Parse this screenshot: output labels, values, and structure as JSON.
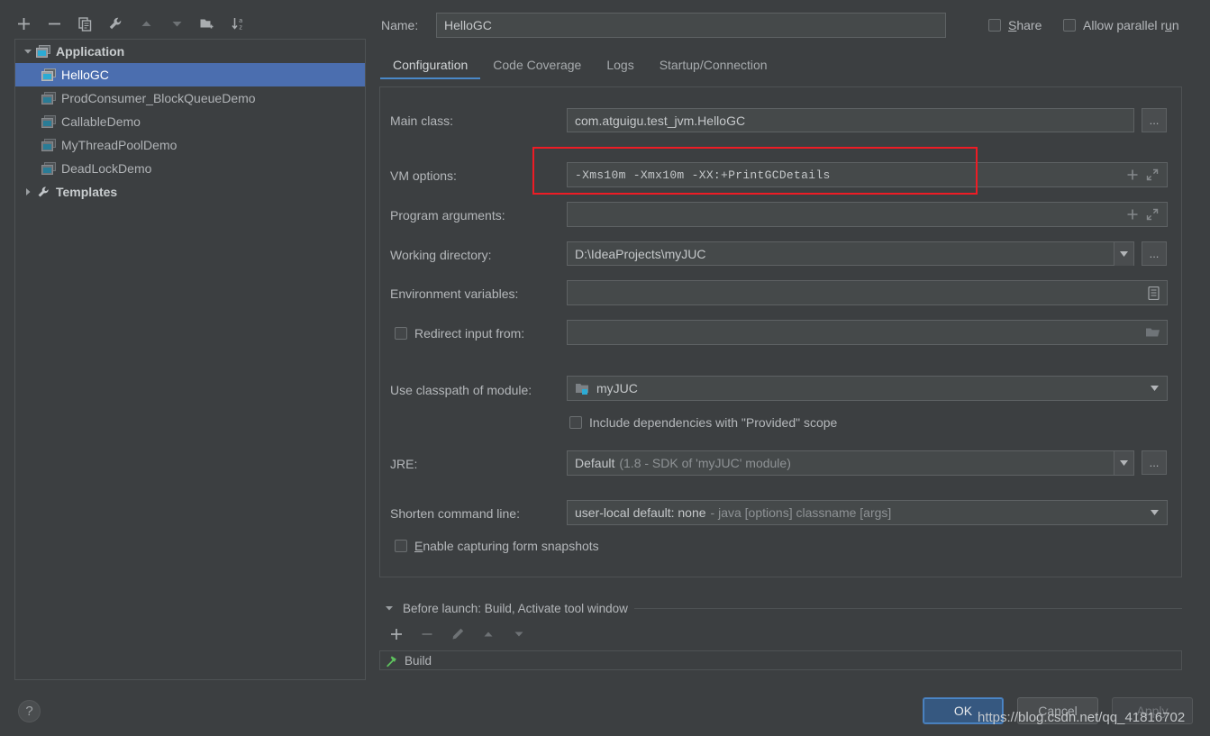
{
  "colors": {
    "background": "#3c3f41",
    "selection_blue": "#4b6eaf",
    "accent_tab": "#4a88c7",
    "ok_button": "#365880",
    "highlight_red": "#ee1c25",
    "field_background": "#45494a",
    "text": "#b4b7ba"
  },
  "tree_toolbar": {
    "items": [
      {
        "icon": "plus-icon",
        "enabled": true
      },
      {
        "icon": "minus-icon",
        "enabled": true
      },
      {
        "icon": "copy-icon",
        "enabled": true
      },
      {
        "icon": "wrench-icon",
        "enabled": true
      },
      {
        "icon": "arrow-up-icon",
        "enabled": false
      },
      {
        "icon": "arrow-down-icon",
        "enabled": false
      },
      {
        "icon": "new-folder-icon",
        "enabled": true
      },
      {
        "icon": "sort-alphabetical-icon",
        "enabled": true
      }
    ]
  },
  "tree": {
    "nodes": [
      {
        "label": "Application",
        "icon": "application-icon",
        "level": 0,
        "expanded": true,
        "bold": true,
        "selected": false
      },
      {
        "label": "HelloGC",
        "icon": "run-config-icon",
        "level": 1,
        "expanded": null,
        "bold": false,
        "selected": true
      },
      {
        "label": "ProdConsumer_BlockQueueDemo",
        "icon": "run-config-icon",
        "level": 1,
        "expanded": null,
        "bold": false,
        "selected": false
      },
      {
        "label": "CallableDemo",
        "icon": "run-config-icon",
        "level": 1,
        "expanded": null,
        "bold": false,
        "selected": false
      },
      {
        "label": "MyThreadPoolDemo",
        "icon": "run-config-icon",
        "level": 1,
        "expanded": null,
        "bold": false,
        "selected": false
      },
      {
        "label": "DeadLockDemo",
        "icon": "run-config-icon",
        "level": 1,
        "expanded": null,
        "bold": false,
        "selected": false
      },
      {
        "label": "Templates",
        "icon": "wrench-icon",
        "level": 0,
        "expanded": false,
        "bold": true,
        "selected": false
      }
    ]
  },
  "help": {
    "glyph": "?"
  },
  "header": {
    "name_label": "Name:",
    "name_value": "HelloGC",
    "name_placeholder": "",
    "share": {
      "label": "Share",
      "accel": "S",
      "checked": false
    },
    "parallel": {
      "label": "Allow parallel run",
      "accel": "u",
      "checked": false
    }
  },
  "tabs": [
    {
      "label": "Configuration",
      "active": true
    },
    {
      "label": "Code Coverage",
      "active": false
    },
    {
      "label": "Logs",
      "active": false
    },
    {
      "label": "Startup/Connection",
      "active": false
    }
  ],
  "form": {
    "main_class": {
      "label": "Main class:",
      "value": "com.atguigu.test_jvm.HelloGC",
      "browse_label": "..."
    },
    "vm_options": {
      "label": "VM options:",
      "value": "-Xms10m -Xmx10m -XX:+PrintGCDetails",
      "highlighted": true
    },
    "program_arguments": {
      "label": "Program arguments:",
      "value": ""
    },
    "working_directory": {
      "label": "Working directory:",
      "value": "D:\\IdeaProjects\\myJUC",
      "browse_label": "..."
    },
    "environment_variables": {
      "label": "Environment variables:",
      "value": ""
    },
    "redirect_input": {
      "label": "Redirect input from:",
      "checked": false,
      "value": ""
    },
    "classpath_module": {
      "label": "Use classpath of module:",
      "value": "myJUC"
    },
    "include_provided": {
      "label": "Include dependencies with \"Provided\" scope",
      "checked": false
    },
    "jre": {
      "label": "JRE:",
      "value_strong": "Default",
      "value_dim": "(1.8 - SDK of 'myJUC' module)",
      "browse_label": "..."
    },
    "shorten_command_line": {
      "label": "Shorten command line:",
      "value_strong": "user-local default: none",
      "value_dim": "- java [options] classname [args]"
    },
    "form_snapshots": {
      "label": "Enable capturing form snapshots",
      "accel": "E",
      "checked": false
    }
  },
  "before_launch": {
    "title": "Before launch: Build, Activate tool window",
    "expanded": true,
    "toolbar": [
      {
        "icon": "plus-icon",
        "enabled": true
      },
      {
        "icon": "minus-icon",
        "enabled": false
      },
      {
        "icon": "pencil-icon",
        "enabled": false
      },
      {
        "icon": "arrow-up-icon",
        "enabled": false
      },
      {
        "icon": "arrow-down-icon",
        "enabled": false
      }
    ],
    "items": [
      {
        "label": "Build",
        "icon": "hammer-icon"
      }
    ]
  },
  "buttons": {
    "ok": "OK",
    "cancel": "Cancel",
    "apply": "Apply"
  },
  "watermark": "https://blog.csdn.net/qq_41816702"
}
